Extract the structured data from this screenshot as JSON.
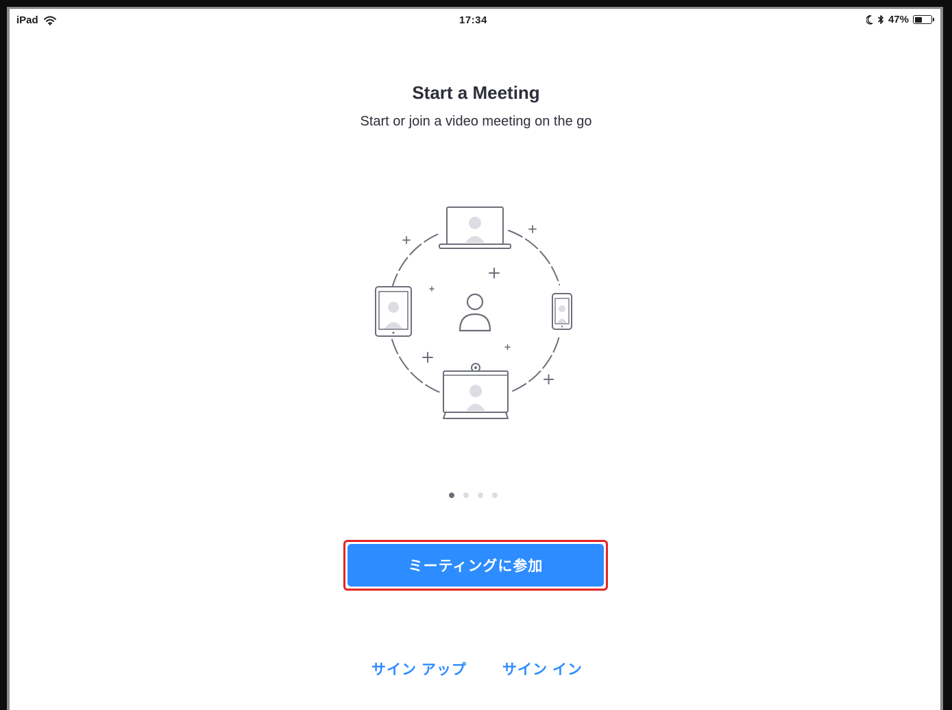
{
  "status_bar": {
    "device": "iPad",
    "time": "17:34",
    "battery_percent": "47%",
    "battery_level": 0.47,
    "icons": [
      "wifi-icon",
      "moon-icon",
      "bluetooth-icon",
      "battery-icon"
    ]
  },
  "intro": {
    "title": "Start a Meeting",
    "subtitle": "Start or join a video meeting on the go"
  },
  "pager": {
    "total": 4,
    "active_index": 0
  },
  "actions": {
    "join_label": "ミーティングに参加",
    "signup_label": "サイン アップ",
    "signin_label": "サイン イン"
  },
  "colors": {
    "accent": "#2d8cff",
    "highlight_border": "#e62323",
    "text_dark": "#2d2f3a",
    "illustration_stroke": "#6c6f7a"
  }
}
